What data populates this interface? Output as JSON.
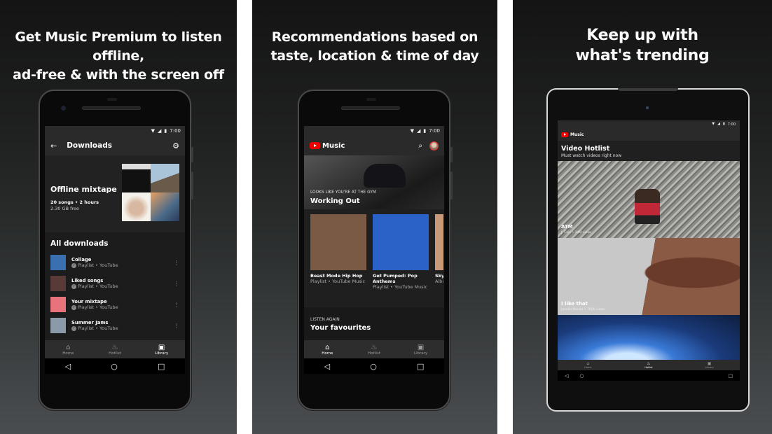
{
  "panels": [
    {
      "caption_line1": "Get Music Premium to listen offline,",
      "caption_line2": "ad-free & with the screen off",
      "status": {
        "time": "7:00"
      },
      "appbar": {
        "back_icon": "arrow-left-icon",
        "title": "Downloads",
        "settings_icon": "gear-icon"
      },
      "mixtape": {
        "title": "Offline mixtape",
        "meta": "20 songs • 2 hours",
        "storage": "2.30 GB free"
      },
      "section_title": "All downloads",
      "downloads": [
        {
          "name": "Collage",
          "sub": "Playlist • YouTube",
          "color": "#3a6fb0"
        },
        {
          "name": "Liked songs",
          "sub": "Playlist • YouTube",
          "color": "#5a3a36"
        },
        {
          "name": "Your mixtape",
          "sub": "Playlist • YouTube",
          "color": "#e8737a"
        },
        {
          "name": "Summer Jams",
          "sub": "Playlist • YouTube",
          "color": "#8a9aa8"
        }
      ],
      "nav": [
        {
          "label": "Home",
          "icon": "home-icon",
          "active": false
        },
        {
          "label": "Hotlist",
          "icon": "flame-icon",
          "active": false
        },
        {
          "label": "Library",
          "icon": "library-icon",
          "active": true
        }
      ]
    },
    {
      "caption_line1": "Recommendations based on",
      "caption_line2": "taste, location & time of day",
      "status": {
        "time": "7:00"
      },
      "appbar": {
        "brand": "Music",
        "search_icon": "search-icon",
        "avatar_icon": "avatar"
      },
      "hero": {
        "kicker": "LOOKS LIKE YOU'RE AT THE GYM",
        "title": "Working Out"
      },
      "cards": [
        {
          "title": "Beast Mode Hip Hop",
          "sub": "Playlist • YouTube Music",
          "color": "#7a5a44"
        },
        {
          "title": "Get Pumped: Pop Anthems",
          "sub": "Playlist • YouTube Music",
          "color": "#2a62c8"
        },
        {
          "title": "Sky",
          "sub": "Albu",
          "color": "#c89a78"
        }
      ],
      "listen_again": {
        "kicker": "LISTEN AGAIN",
        "title": "Your favourites"
      },
      "favourites_colors": [
        "#3a8a84",
        "#f0a090",
        "#18b8d0"
      ],
      "nav": [
        {
          "label": "Home",
          "icon": "home-icon",
          "active": true
        },
        {
          "label": "Hotlist",
          "icon": "flame-icon",
          "active": false
        },
        {
          "label": "Library",
          "icon": "library-icon",
          "active": false
        }
      ]
    },
    {
      "caption_line1": "Keep up with",
      "caption_line2": "what's trending",
      "status": {
        "time": "7:00"
      },
      "appbar": {
        "brand": "Music"
      },
      "hotlist": {
        "title": "Video Hotlist",
        "subtitle": "Must watch videos right now"
      },
      "videos": [
        {
          "title": "ATM",
          "sub": "J. Cole • 14M views"
        },
        {
          "title": "I like that",
          "sub": "Janelle Monáe • 791K views"
        },
        {
          "title": "",
          "sub": ""
        }
      ],
      "nav": [
        {
          "label": "Home",
          "icon": "home-icon",
          "active": false
        },
        {
          "label": "Hotlist",
          "icon": "flame-icon",
          "active": true
        },
        {
          "label": "Library",
          "icon": "library-icon",
          "active": false
        }
      ]
    }
  ],
  "system_nav": {
    "back": "◁",
    "home": "○",
    "recents": "□"
  }
}
